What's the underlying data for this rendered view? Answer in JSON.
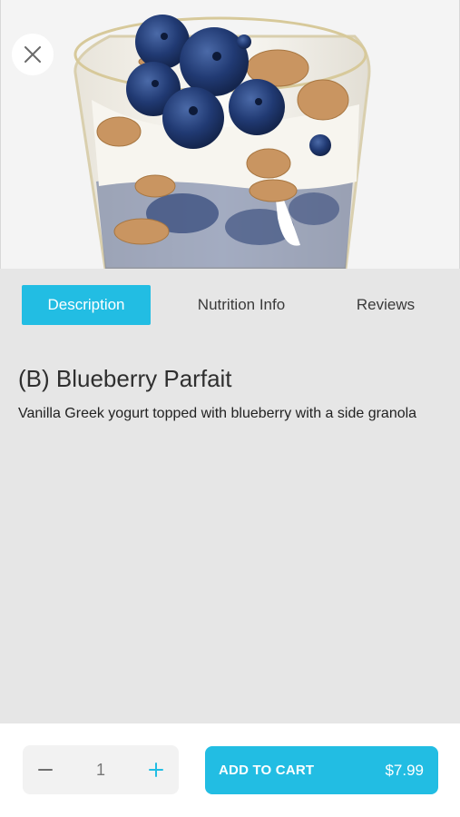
{
  "product": {
    "title": "(B) Blueberry Parfait",
    "description": "Vanilla Greek yogurt topped with blueberry with a side granola",
    "image_subject": "blueberry parfait in a glass"
  },
  "tabs": [
    {
      "label": "Description",
      "active": true
    },
    {
      "label": "Nutrition Info",
      "active": false
    },
    {
      "label": "Reviews",
      "active": false
    }
  ],
  "cart": {
    "quantity": "1",
    "add_label": "ADD TO CART",
    "price": "$7.99"
  },
  "icons": {
    "close": "close-icon",
    "minus": "minus-icon",
    "plus": "plus-icon"
  },
  "colors": {
    "accent": "#22bde3",
    "background": "#e6e6e6",
    "bottom_bar": "#ffffff"
  }
}
